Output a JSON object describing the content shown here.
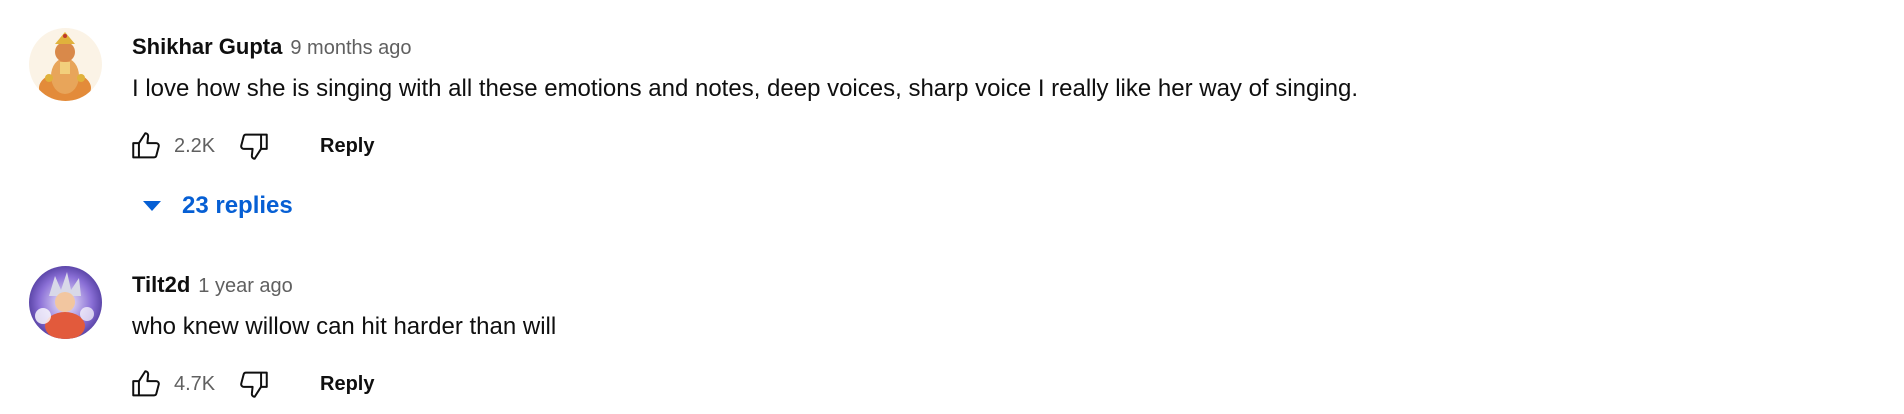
{
  "comments": [
    {
      "author": "Shikhar Gupta",
      "timestamp": "9 months ago",
      "text": "I love how she is singing with all these emotions and notes, deep voices, sharp voice I really like her way of singing.",
      "likes": "2.2K",
      "reply_label": "Reply",
      "replies_label": "23 replies",
      "avatar_icon": "deity-illustration-avatar"
    },
    {
      "author": "Tilt2d",
      "timestamp": "1 year ago",
      "text": "who knew willow can hit harder than will",
      "likes": "4.7K",
      "reply_label": "Reply",
      "avatar_icon": "anime-character-avatar"
    }
  ],
  "colors": {
    "link_blue": "#065fd4",
    "secondary_text": "#606060",
    "primary_text": "#0f0f0f"
  },
  "icons": {
    "like": "thumbs-up-icon",
    "dislike": "thumbs-down-icon",
    "expand": "caret-down-icon"
  }
}
